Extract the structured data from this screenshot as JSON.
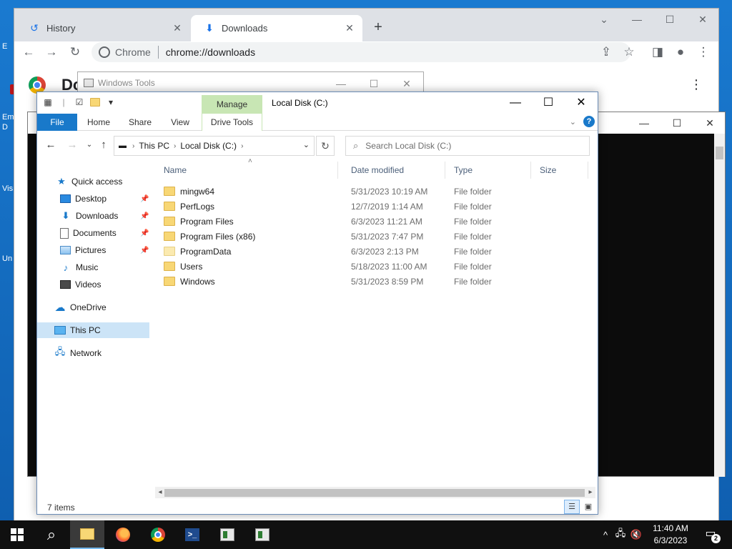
{
  "desktop": {
    "labels": [
      "E",
      "Em",
      "D",
      "Vis",
      "Un"
    ]
  },
  "chrome": {
    "tabs": [
      {
        "label": "History",
        "icon": "history-icon",
        "active": false
      },
      {
        "label": "Downloads",
        "icon": "download-icon",
        "active": true
      }
    ],
    "site_label": "Chrome",
    "url": "chrome://downloads",
    "page_title": "Do"
  },
  "windows_tools": {
    "title": "Windows Tools"
  },
  "explorer": {
    "title": "Local Disk (C:)",
    "manage_label": "Manage",
    "ribbon_tabs": [
      "File",
      "Home",
      "Share",
      "View",
      "Drive Tools"
    ],
    "breadcrumb": [
      "This PC",
      "Local Disk (C:)"
    ],
    "search_placeholder": "Search Local Disk (C:)",
    "columns": [
      "Name",
      "Date modified",
      "Type",
      "Size"
    ],
    "nav": [
      {
        "label": "Quick access",
        "icon": "star-icon",
        "pinned": false
      },
      {
        "label": "Desktop",
        "icon": "desktop-icon",
        "pinned": true
      },
      {
        "label": "Downloads",
        "icon": "downloads-icon",
        "pinned": true
      },
      {
        "label": "Documents",
        "icon": "documents-icon",
        "pinned": true
      },
      {
        "label": "Pictures",
        "icon": "pictures-icon",
        "pinned": true
      },
      {
        "label": "Music",
        "icon": "music-icon",
        "pinned": false
      },
      {
        "label": "Videos",
        "icon": "videos-icon",
        "pinned": false
      },
      {
        "label": "OneDrive",
        "icon": "cloud-icon",
        "pinned": false
      },
      {
        "label": "This PC",
        "icon": "computer-icon",
        "pinned": false,
        "selected": true
      },
      {
        "label": "Network",
        "icon": "network-icon",
        "pinned": false
      }
    ],
    "files": [
      {
        "name": "mingw64",
        "date": "5/31/2023 10:19 AM",
        "type": "File folder"
      },
      {
        "name": "PerfLogs",
        "date": "12/7/2019 1:14 AM",
        "type": "File folder"
      },
      {
        "name": "Program Files",
        "date": "6/3/2023 11:21 AM",
        "type": "File folder"
      },
      {
        "name": "Program Files (x86)",
        "date": "5/31/2023 7:47 PM",
        "type": "File folder"
      },
      {
        "name": "ProgramData",
        "date": "6/3/2023 2:13 PM",
        "type": "File folder"
      },
      {
        "name": "Users",
        "date": "5/18/2023 11:00 AM",
        "type": "File folder"
      },
      {
        "name": "Windows",
        "date": "5/31/2023 8:59 PM",
        "type": "File folder"
      }
    ],
    "status": "7 items"
  },
  "taskbar": {
    "time": "11:40 AM",
    "date": "6/3/2023",
    "notification_count": "2",
    "powershell_glyph": ">_"
  }
}
